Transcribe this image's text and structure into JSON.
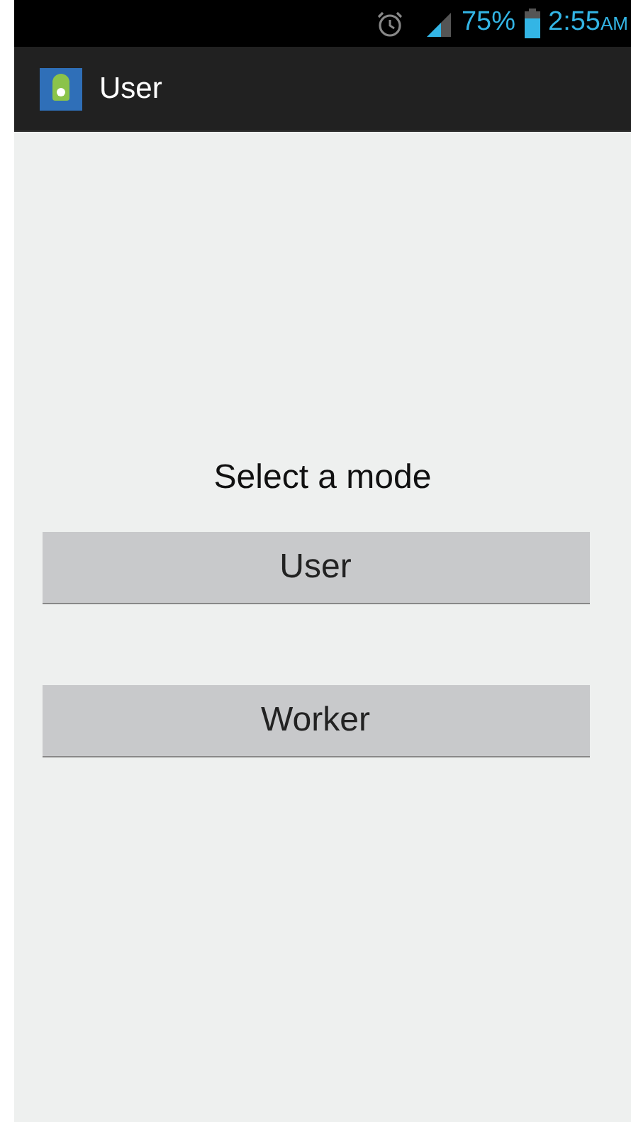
{
  "status_bar": {
    "battery_percent": "75%",
    "time": "2:55",
    "meridiem": "AM"
  },
  "action_bar": {
    "title": "User"
  },
  "prompt": "Select a mode",
  "buttons": [
    {
      "label": "User"
    },
    {
      "label": "Worker"
    }
  ]
}
